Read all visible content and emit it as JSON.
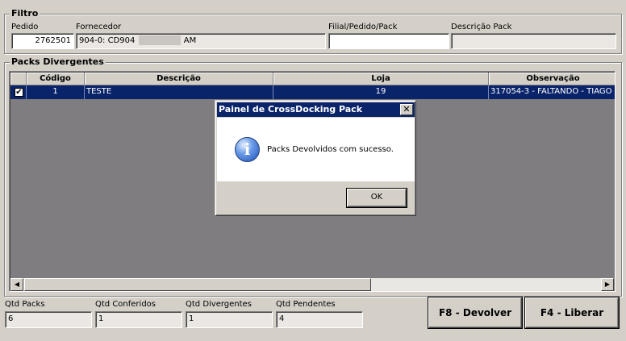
{
  "filtro": {
    "title": "Filtro",
    "pedido_label": "Pedido",
    "pedido_value": "2762501",
    "fornecedor_label": "Fornecedor",
    "fornecedor_value_prefix": "904-0: CD904",
    "fornecedor_value_suffix": "AM",
    "filial_label": "Filial/Pedido/Pack",
    "filial_value": "",
    "descricao_pack_label": "Descrição Pack",
    "descricao_pack_value": ""
  },
  "packs": {
    "title": "Packs Divergentes",
    "columns": [
      "Código",
      "Descrição",
      "Loja",
      "Observação"
    ],
    "rows": [
      {
        "checked": true,
        "codigo": "1",
        "descricao": "TESTE",
        "loja": "19",
        "observacao": "317054-3 - FALTANDO - TIAGO"
      }
    ]
  },
  "summary": {
    "qtd_packs_label": "Qtd Packs",
    "qtd_packs": "6",
    "qtd_conferidos_label": "Qtd Conferidos",
    "qtd_conferidos": "1",
    "qtd_divergentes_label": "Qtd Divergentes",
    "qtd_divergentes": "1",
    "qtd_pendentes_label": "Qtd Pendentes",
    "qtd_pendentes": "4"
  },
  "actions": {
    "devolver_label": "F8 - Devolver",
    "liberar_label": "F4 - Liberar"
  },
  "dialog": {
    "title": "Painel de CrossDocking Pack",
    "message": "Packs Devolvidos com sucesso.",
    "ok_label": "OK",
    "icon": "info-icon"
  },
  "colors": {
    "window_bg": "#d4d0c8",
    "selection": "#0a246a",
    "grid_bg": "#807d80"
  }
}
